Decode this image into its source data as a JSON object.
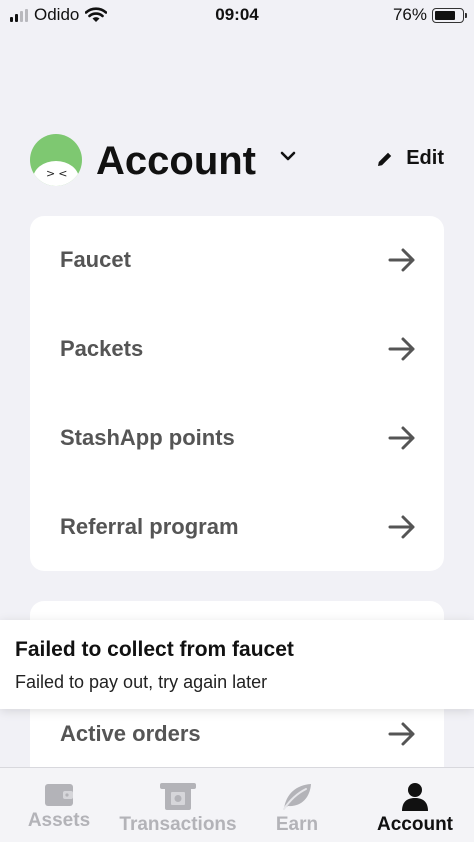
{
  "status_bar": {
    "carrier": "Odido",
    "time": "09:04",
    "battery": "76%",
    "battery_level": 0.76
  },
  "header": {
    "title": "Account",
    "edit_label": "Edit"
  },
  "menu": {
    "items": [
      {
        "label": "Faucet"
      },
      {
        "label": "Packets"
      },
      {
        "label": "StashApp points"
      },
      {
        "label": "Referral program"
      }
    ]
  },
  "menu2": {
    "items": [
      {
        "label": "Active orders"
      }
    ]
  },
  "toast": {
    "title": "Failed to collect from faucet",
    "message": "Failed to pay out, try again later"
  },
  "tabbar": {
    "tabs": [
      {
        "label": "Assets",
        "icon": "wallet-icon",
        "active": false
      },
      {
        "label": "Transactions",
        "icon": "receipt-icon",
        "active": false
      },
      {
        "label": "Earn",
        "icon": "leaf-icon",
        "active": false
      },
      {
        "label": "Account",
        "icon": "person-icon",
        "active": true
      }
    ]
  },
  "colors": {
    "avatar": "#7ec871",
    "background": "#f1f1f6",
    "inactive_tab": "#b3b3b8"
  }
}
